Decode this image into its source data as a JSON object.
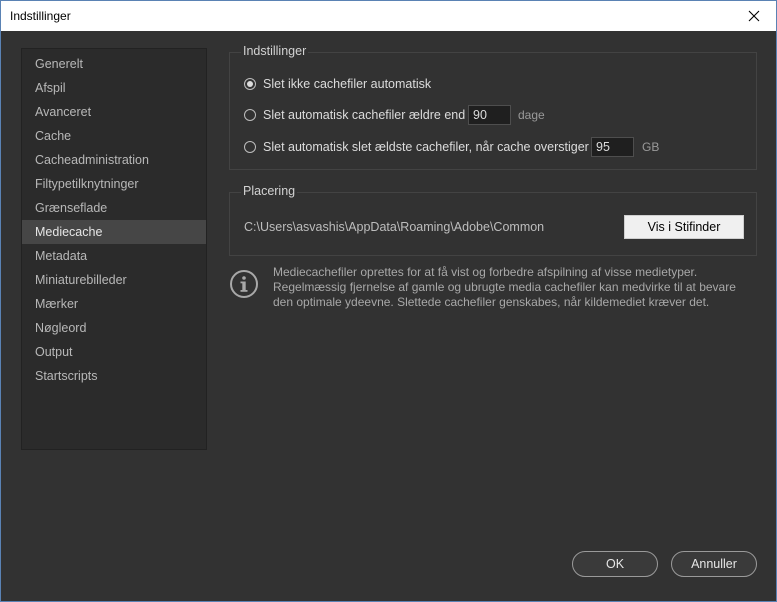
{
  "window": {
    "title": "Indstillinger"
  },
  "sidebar": {
    "items": [
      {
        "label": "Generelt"
      },
      {
        "label": "Afspil"
      },
      {
        "label": "Avanceret"
      },
      {
        "label": "Cache"
      },
      {
        "label": "Cacheadministration"
      },
      {
        "label": "Filtypetilknytninger"
      },
      {
        "label": "Grænseflade"
      },
      {
        "label": "Mediecache"
      },
      {
        "label": "Metadata"
      },
      {
        "label": "Miniaturebilleder"
      },
      {
        "label": "Mærker"
      },
      {
        "label": "Nøgleord"
      },
      {
        "label": "Output"
      },
      {
        "label": "Startscripts"
      }
    ],
    "selected": "Mediecache"
  },
  "settings_group": {
    "title": "Indstillinger",
    "option1": {
      "label": "Slet ikke cachefiler automatisk",
      "checked": true
    },
    "option2": {
      "label": "Slet automatisk cachefiler ældre end",
      "value": "90",
      "unit": "dage",
      "checked": false
    },
    "option3": {
      "label": "Slet automatisk slet ældste cachefiler, når cache overstiger",
      "value": "95",
      "unit": "GB",
      "checked": false
    }
  },
  "location_group": {
    "title": "Placering",
    "path": "C:\\Users\\asvashis\\AppData\\Roaming\\Adobe\\Common",
    "reveal_button": "Vis i Stifinder"
  },
  "info": {
    "lines": [
      "Mediecachefiler oprettes for at få vist og forbedre afspilning af visse medietyper.",
      "Regelmæssig fjernelse af gamle og ubrugte media cachefiler kan medvirke til at bevare",
      "den optimale ydeevne. Slettede cachefiler genskabes, når kildemediet kræver det."
    ]
  },
  "footer": {
    "ok_label": "OK",
    "cancel_label": "Annuller"
  }
}
